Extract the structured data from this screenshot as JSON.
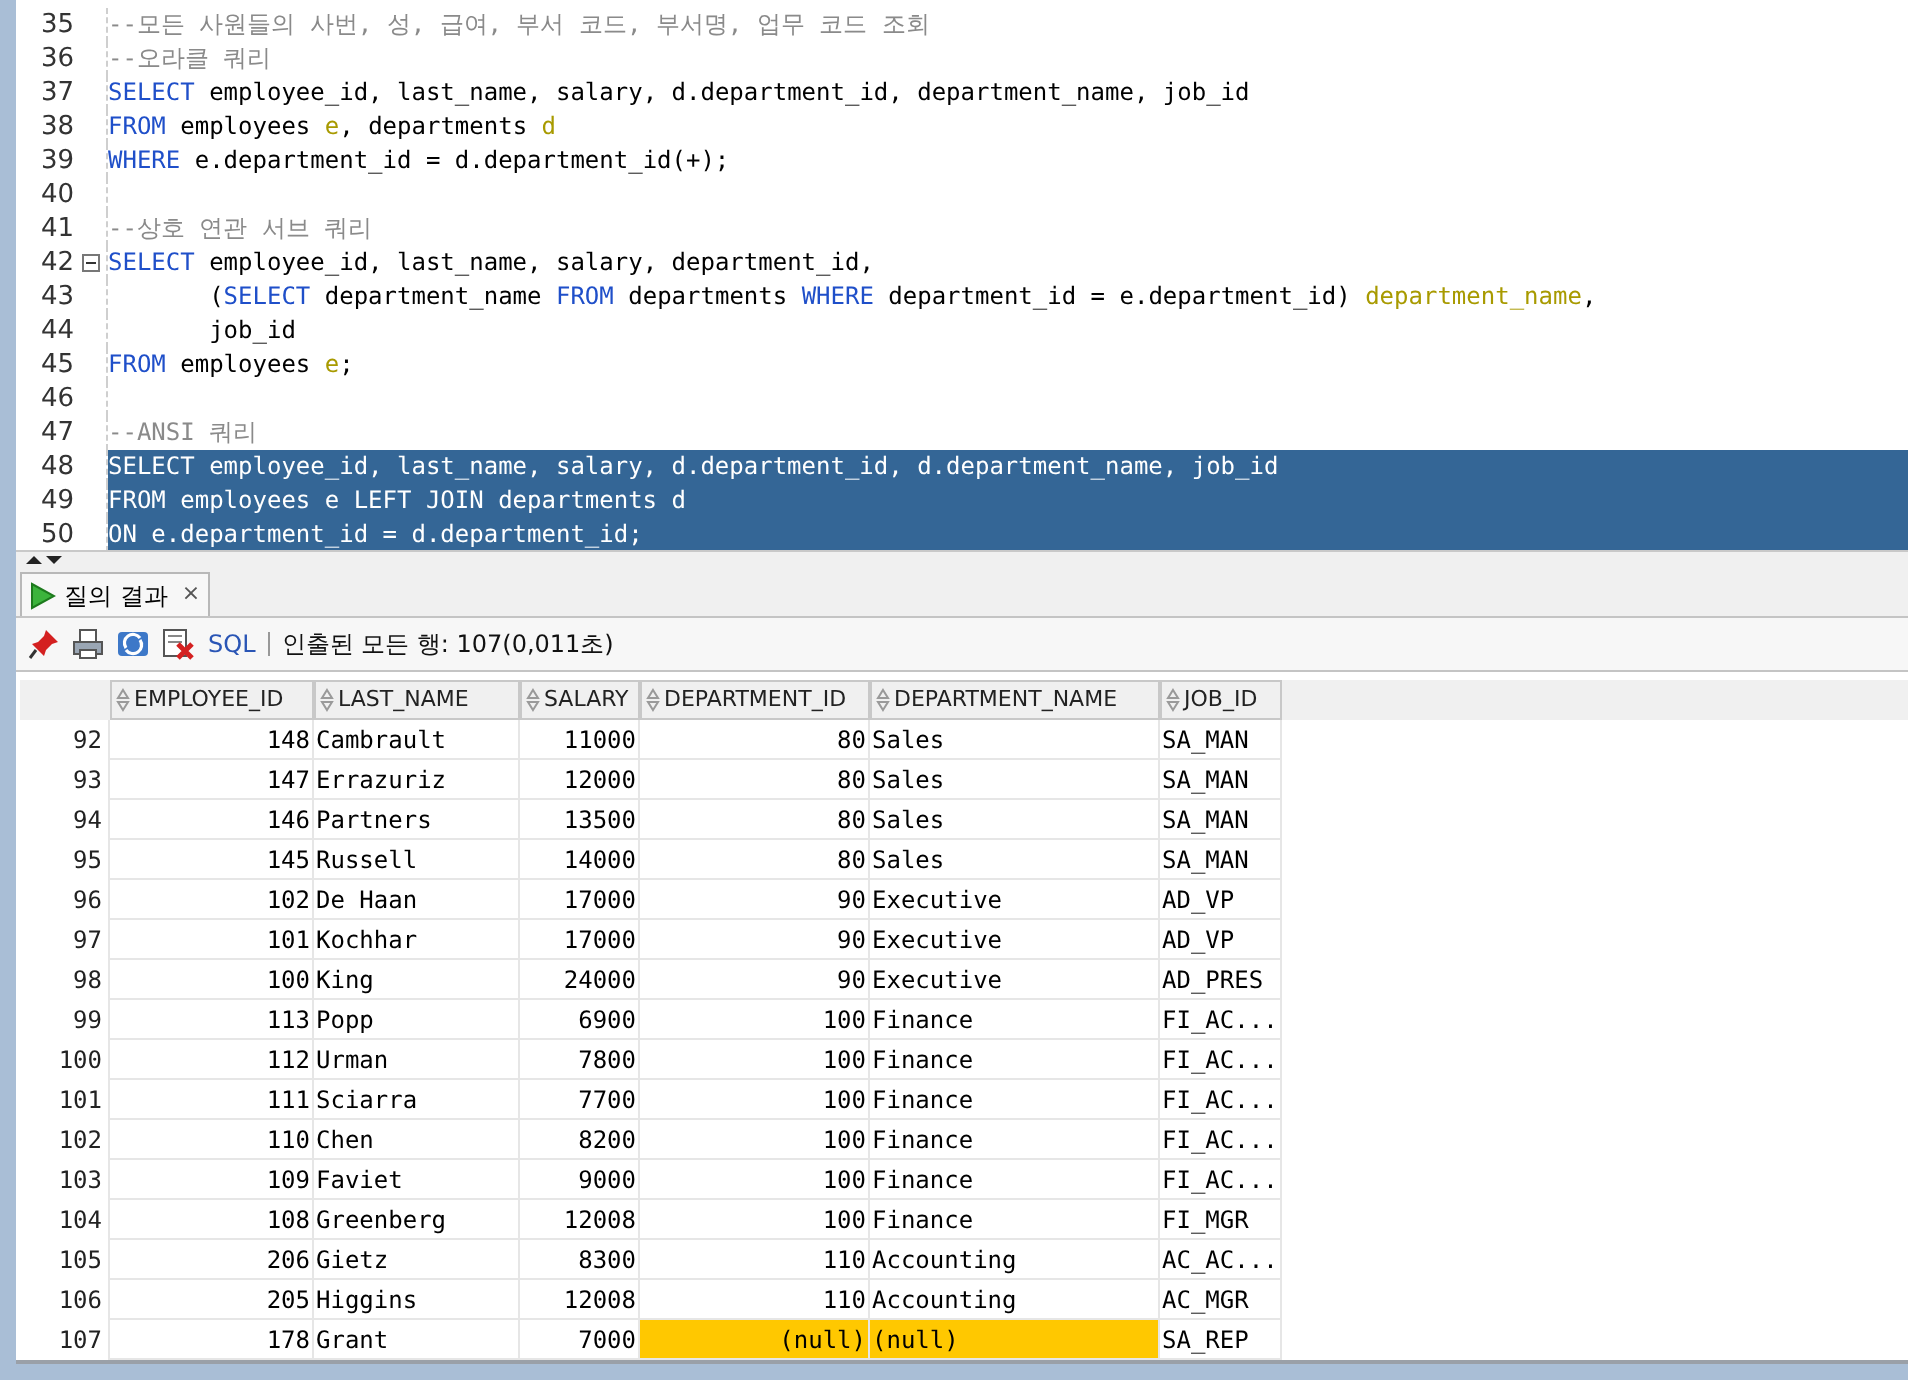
{
  "editor": {
    "lines": [
      {
        "number": "35",
        "selected": false,
        "fold": false,
        "segments": [
          {
            "kind": "comment",
            "text": "--모든 사원들의 사번, 성, 급여, 부서 코드, 부서명, 업무 코드 조회"
          }
        ]
      },
      {
        "number": "36",
        "selected": false,
        "fold": false,
        "segments": [
          {
            "kind": "comment",
            "text": "--오라클 쿼리"
          }
        ]
      },
      {
        "number": "37",
        "selected": false,
        "fold": false,
        "segments": [
          {
            "kind": "keyword",
            "text": "SELECT"
          },
          {
            "kind": "plain",
            "text": " employee_id, last_name, salary, d.department_id, department_name, job_id"
          }
        ]
      },
      {
        "number": "38",
        "selected": false,
        "fold": false,
        "segments": [
          {
            "kind": "keyword",
            "text": "FROM"
          },
          {
            "kind": "plain",
            "text": " employees "
          },
          {
            "kind": "alias",
            "text": "e"
          },
          {
            "kind": "plain",
            "text": ", departments "
          },
          {
            "kind": "alias",
            "text": "d"
          }
        ]
      },
      {
        "number": "39",
        "selected": false,
        "fold": false,
        "segments": [
          {
            "kind": "keyword",
            "text": "WHERE"
          },
          {
            "kind": "plain",
            "text": " e.department_id = d.department_id(+);"
          }
        ]
      },
      {
        "number": "40",
        "selected": false,
        "fold": false
      },
      {
        "number": "41",
        "selected": false,
        "fold": false,
        "segments": [
          {
            "kind": "comment",
            "text": "--상호 연관 서브 쿼리"
          }
        ]
      },
      {
        "number": "42",
        "selected": false,
        "fold": true,
        "segments": [
          {
            "kind": "keyword",
            "text": "SELECT"
          },
          {
            "kind": "plain",
            "text": " employee_id, last_name, salary, department_id,"
          }
        ]
      },
      {
        "number": "43",
        "selected": false,
        "fold": false,
        "segments": [
          {
            "kind": "plain",
            "text": "       ("
          },
          {
            "kind": "keyword",
            "text": "SELECT"
          },
          {
            "kind": "plain",
            "text": " department_name "
          },
          {
            "kind": "keyword",
            "text": "FROM"
          },
          {
            "kind": "plain",
            "text": " departments "
          },
          {
            "kind": "keyword",
            "text": "WHERE"
          },
          {
            "kind": "plain",
            "text": " department_id = e.department_id) "
          },
          {
            "kind": "alias",
            "text": "department_name"
          },
          {
            "kind": "plain",
            "text": ","
          }
        ]
      },
      {
        "number": "44",
        "selected": false,
        "fold": false,
        "segments": [
          {
            "kind": "plain",
            "text": "       job_id"
          }
        ]
      },
      {
        "number": "45",
        "selected": false,
        "fold": false,
        "segments": [
          {
            "kind": "keyword",
            "text": "FROM"
          },
          {
            "kind": "plain",
            "text": " employees "
          },
          {
            "kind": "alias",
            "text": "e"
          },
          {
            "kind": "plain",
            "text": ";"
          }
        ]
      },
      {
        "number": "46",
        "selected": false,
        "fold": false
      },
      {
        "number": "47",
        "selected": false,
        "fold": false,
        "segments": [
          {
            "kind": "comment",
            "text": "--ANSI 쿼리"
          }
        ]
      },
      {
        "number": "48",
        "selected": true,
        "fold": false,
        "segments": [
          {
            "kind": "plain",
            "text": "SELECT employee_id, last_name, salary, d.department_id, d.department_name, job_id"
          }
        ]
      },
      {
        "number": "49",
        "selected": true,
        "fold": false,
        "segments": [
          {
            "kind": "plain",
            "text": "FROM employees e LEFT JOIN departments d"
          }
        ]
      },
      {
        "number": "50",
        "selected": true,
        "fold": false,
        "segments": [
          {
            "kind": "plain",
            "text": "ON e.department_id = d.department_id;"
          }
        ]
      }
    ]
  },
  "results_tab": {
    "label": "질의 결과",
    "close": "×",
    "selected": true
  },
  "toolbar": {
    "sql": "SQL",
    "status": "인출된 모든 행: 107(0,011초)"
  },
  "table": {
    "columns": [
      "EMPLOYEE_ID",
      "LAST_NAME",
      "SALARY",
      "DEPARTMENT_ID",
      "DEPARTMENT_NAME",
      "JOB_ID"
    ],
    "rows": [
      {
        "number": "92",
        "cells": [
          {
            "text": "148",
            "highlighted": false
          },
          {
            "text": "Cambrault",
            "highlighted": false
          },
          {
            "text": "11000",
            "highlighted": false
          },
          {
            "text": "80",
            "highlighted": false
          },
          {
            "text": "Sales",
            "highlighted": false
          },
          {
            "text": "SA_MAN",
            "highlighted": false
          }
        ]
      },
      {
        "number": "93",
        "cells": [
          {
            "text": "147",
            "highlighted": false
          },
          {
            "text": "Errazuriz",
            "highlighted": false
          },
          {
            "text": "12000",
            "highlighted": false
          },
          {
            "text": "80",
            "highlighted": false
          },
          {
            "text": "Sales",
            "highlighted": false
          },
          {
            "text": "SA_MAN",
            "highlighted": false
          }
        ]
      },
      {
        "number": "94",
        "cells": [
          {
            "text": "146",
            "highlighted": false
          },
          {
            "text": "Partners",
            "highlighted": false
          },
          {
            "text": "13500",
            "highlighted": false
          },
          {
            "text": "80",
            "highlighted": false
          },
          {
            "text": "Sales",
            "highlighted": false
          },
          {
            "text": "SA_MAN",
            "highlighted": false
          }
        ]
      },
      {
        "number": "95",
        "cells": [
          {
            "text": "145",
            "highlighted": false
          },
          {
            "text": "Russell",
            "highlighted": false
          },
          {
            "text": "14000",
            "highlighted": false
          },
          {
            "text": "80",
            "highlighted": false
          },
          {
            "text": "Sales",
            "highlighted": false
          },
          {
            "text": "SA_MAN",
            "highlighted": false
          }
        ]
      },
      {
        "number": "96",
        "cells": [
          {
            "text": "102",
            "highlighted": false
          },
          {
            "text": "De Haan",
            "highlighted": false
          },
          {
            "text": "17000",
            "highlighted": false
          },
          {
            "text": "90",
            "highlighted": false
          },
          {
            "text": "Executive",
            "highlighted": false
          },
          {
            "text": "AD_VP",
            "highlighted": false
          }
        ]
      },
      {
        "number": "97",
        "cells": [
          {
            "text": "101",
            "highlighted": false
          },
          {
            "text": "Kochhar",
            "highlighted": false
          },
          {
            "text": "17000",
            "highlighted": false
          },
          {
            "text": "90",
            "highlighted": false
          },
          {
            "text": "Executive",
            "highlighted": false
          },
          {
            "text": "AD_VP",
            "highlighted": false
          }
        ]
      },
      {
        "number": "98",
        "cells": [
          {
            "text": "100",
            "highlighted": false
          },
          {
            "text": "King",
            "highlighted": false
          },
          {
            "text": "24000",
            "highlighted": false
          },
          {
            "text": "90",
            "highlighted": false
          },
          {
            "text": "Executive",
            "highlighted": false
          },
          {
            "text": "AD_PRES",
            "highlighted": false
          }
        ]
      },
      {
        "number": "99",
        "cells": [
          {
            "text": "113",
            "highlighted": false
          },
          {
            "text": "Popp",
            "highlighted": false
          },
          {
            "text": "6900",
            "highlighted": false
          },
          {
            "text": "100",
            "highlighted": false
          },
          {
            "text": "Finance",
            "highlighted": false
          },
          {
            "text": "FI_AC...",
            "highlighted": false
          }
        ]
      },
      {
        "number": "100",
        "cells": [
          {
            "text": "112",
            "highlighted": false
          },
          {
            "text": "Urman",
            "highlighted": false
          },
          {
            "text": "7800",
            "highlighted": false
          },
          {
            "text": "100",
            "highlighted": false
          },
          {
            "text": "Finance",
            "highlighted": false
          },
          {
            "text": "FI_AC...",
            "highlighted": false
          }
        ]
      },
      {
        "number": "101",
        "cells": [
          {
            "text": "111",
            "highlighted": false
          },
          {
            "text": "Sciarra",
            "highlighted": false
          },
          {
            "text": "7700",
            "highlighted": false
          },
          {
            "text": "100",
            "highlighted": false
          },
          {
            "text": "Finance",
            "highlighted": false
          },
          {
            "text": "FI_AC...",
            "highlighted": false
          }
        ]
      },
      {
        "number": "102",
        "cells": [
          {
            "text": "110",
            "highlighted": false
          },
          {
            "text": "Chen",
            "highlighted": false
          },
          {
            "text": "8200",
            "highlighted": false
          },
          {
            "text": "100",
            "highlighted": false
          },
          {
            "text": "Finance",
            "highlighted": false
          },
          {
            "text": "FI_AC...",
            "highlighted": false
          }
        ]
      },
      {
        "number": "103",
        "cells": [
          {
            "text": "109",
            "highlighted": false
          },
          {
            "text": "Faviet",
            "highlighted": false
          },
          {
            "text": "9000",
            "highlighted": false
          },
          {
            "text": "100",
            "highlighted": false
          },
          {
            "text": "Finance",
            "highlighted": false
          },
          {
            "text": "FI_AC...",
            "highlighted": false
          }
        ]
      },
      {
        "number": "104",
        "cells": [
          {
            "text": "108",
            "highlighted": false
          },
          {
            "text": "Greenberg",
            "highlighted": false
          },
          {
            "text": "12008",
            "highlighted": false
          },
          {
            "text": "100",
            "highlighted": false
          },
          {
            "text": "Finance",
            "highlighted": false
          },
          {
            "text": "FI_MGR",
            "highlighted": false
          }
        ]
      },
      {
        "number": "105",
        "cells": [
          {
            "text": "206",
            "highlighted": false
          },
          {
            "text": "Gietz",
            "highlighted": false
          },
          {
            "text": "8300",
            "highlighted": false
          },
          {
            "text": "110",
            "highlighted": false
          },
          {
            "text": "Accounting",
            "highlighted": false
          },
          {
            "text": "AC_AC...",
            "highlighted": false
          }
        ]
      },
      {
        "number": "106",
        "cells": [
          {
            "text": "205",
            "highlighted": false
          },
          {
            "text": "Higgins",
            "highlighted": false
          },
          {
            "text": "12008",
            "highlighted": false
          },
          {
            "text": "110",
            "highlighted": false
          },
          {
            "text": "Accounting",
            "highlighted": false
          },
          {
            "text": "AC_MGR",
            "highlighted": false
          }
        ]
      },
      {
        "number": "107",
        "cells": [
          {
            "text": "178",
            "highlighted": false
          },
          {
            "text": "Grant",
            "highlighted": false
          },
          {
            "text": "7000",
            "highlighted": false
          },
          {
            "text": "(null)",
            "highlighted": true
          },
          {
            "text": "(null)",
            "highlighted": true
          },
          {
            "text": "SA_REP",
            "highlighted": false
          }
        ]
      }
    ]
  }
}
